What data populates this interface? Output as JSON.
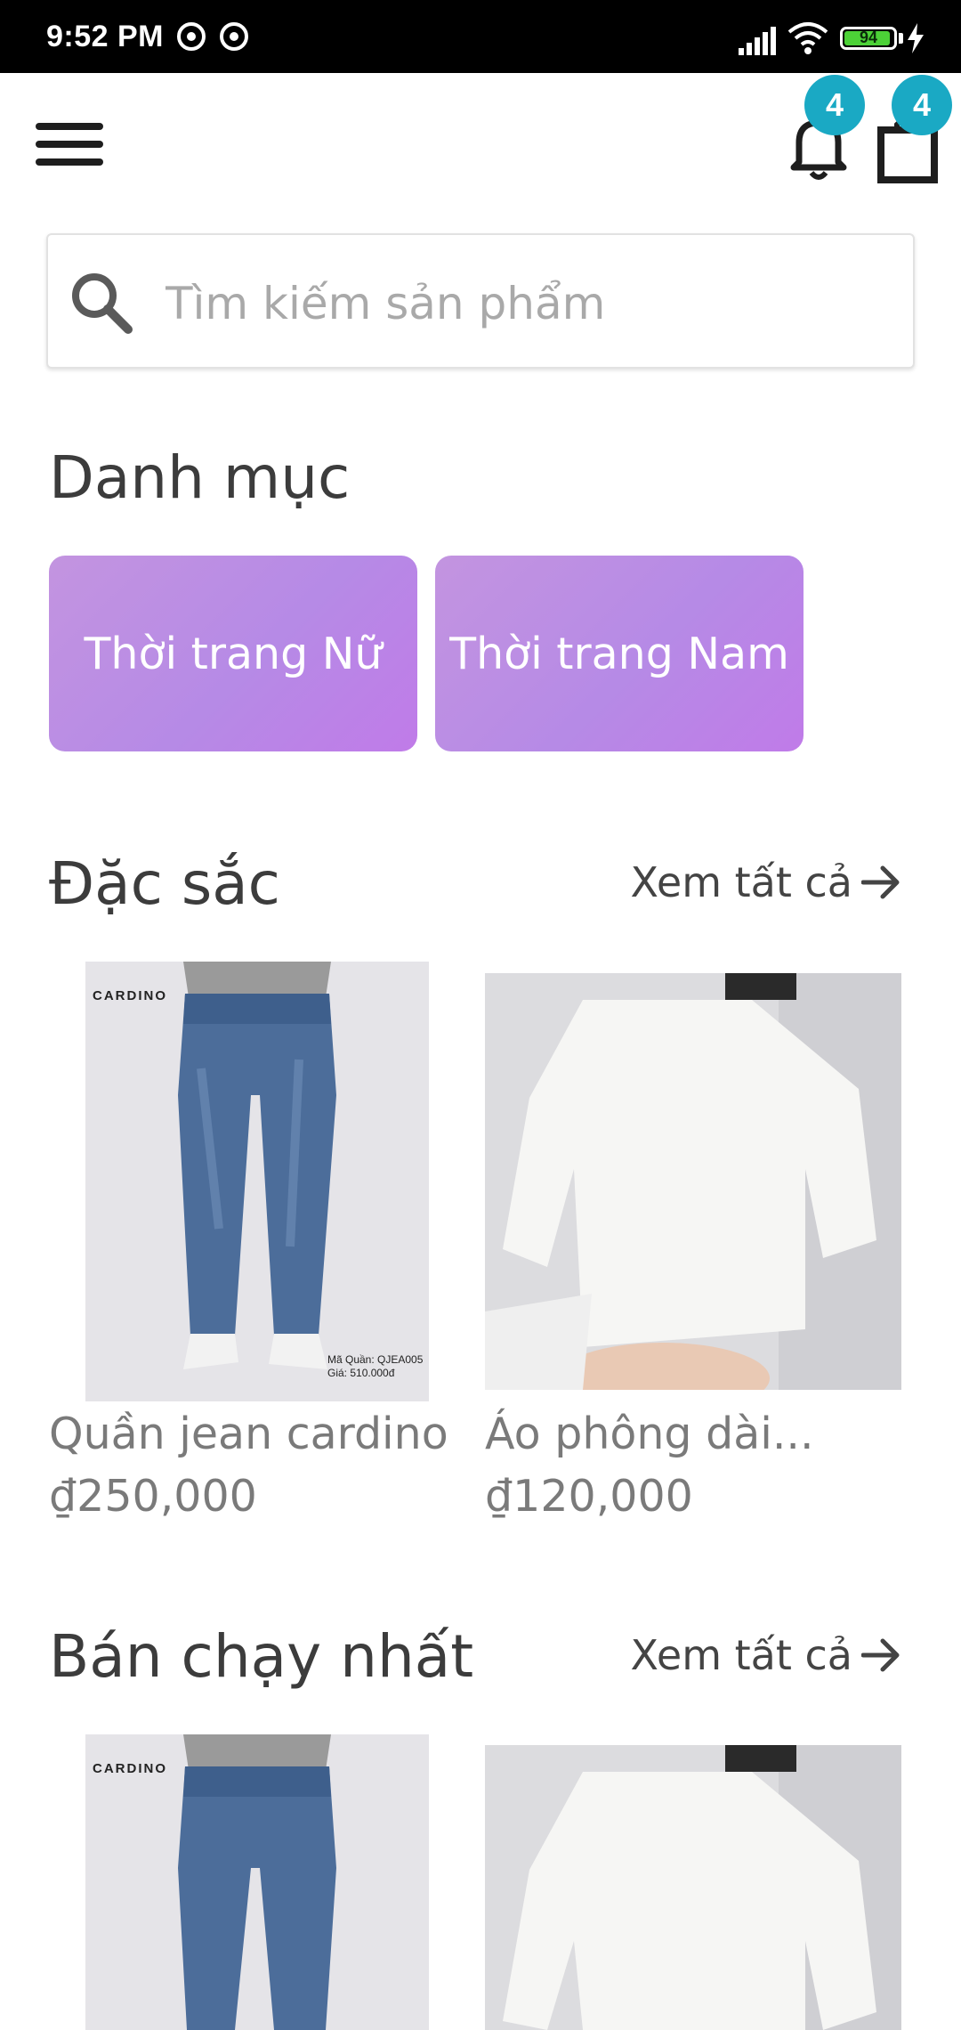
{
  "status_bar": {
    "time": "9:52 PM",
    "battery": "94",
    "battery_level": 0.94,
    "icons": [
      "notification-circle-icon",
      "notification-circle-icon",
      "signal-icon",
      "wifi-icon",
      "battery-icon",
      "charging-bolt-icon"
    ]
  },
  "app_bar": {
    "menu_icon": "hamburger-menu-icon",
    "notifications_badge": "4",
    "cart_badge": "4"
  },
  "search": {
    "placeholder": "Tìm kiếm sản phẩm",
    "value": ""
  },
  "categories": {
    "title": "Danh mục",
    "items": [
      {
        "label": "Thời trang Nữ"
      },
      {
        "label": "Thời trang Nam"
      }
    ]
  },
  "featured": {
    "title": "Đặc sắc",
    "see_all": "Xem tất cả",
    "products": [
      {
        "name": "Quần jean cardino",
        "price": "₫250,000",
        "image": "jeans-product-image",
        "brand": "CARDINO",
        "caption": "Mã Quần: QJEA005 Giá: 510.000đ"
      },
      {
        "name": "Áo phông dài...",
        "price": "₫120,000",
        "image": "white-long-tshirt-product-image"
      }
    ]
  },
  "best_sellers": {
    "title": "Bán chạy nhất",
    "see_all": "Xem tất cả",
    "products": [
      {
        "image": "jeans-product-image",
        "brand": "CARDINO"
      },
      {
        "image": "white-long-tshirt-product-image"
      }
    ]
  },
  "colors": {
    "status_bar_bg": "#000000",
    "badge": "#1aa9c4",
    "category_bg": "#bf8fe4",
    "battery_fill": "#4cd137"
  }
}
